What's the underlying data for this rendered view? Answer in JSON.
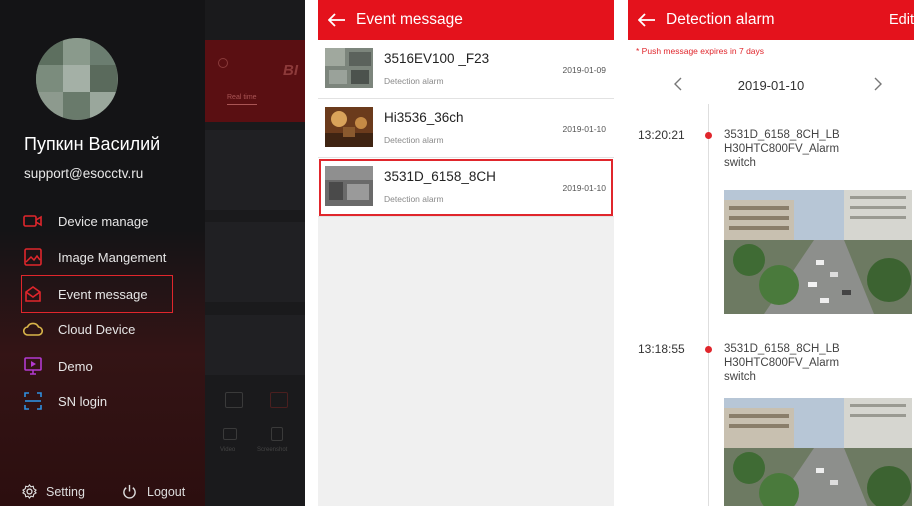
{
  "drawer": {
    "user_name": "Пупкин Василий",
    "user_email": "support@esocctv.ru",
    "menu": [
      {
        "label": "Device manage",
        "icon": "camera-icon",
        "color": "#e0262c"
      },
      {
        "label": "Image Mangement",
        "icon": "image-icon",
        "color": "#e0262c"
      },
      {
        "label": "Event message",
        "icon": "envelope-icon",
        "color": "#e0262c"
      },
      {
        "label": "Cloud Device",
        "icon": "cloud-icon",
        "color": "#d9b54a"
      },
      {
        "label": "Demo",
        "icon": "monitor-play-icon",
        "color": "#b23ad0"
      },
      {
        "label": "SN login",
        "icon": "barcode-icon",
        "color": "#2f8fe0"
      }
    ],
    "active_item": "Event message",
    "setting_label": "Setting",
    "logout_label": "Logout",
    "background_app": {
      "brand_fragment": "BI",
      "tab_label": "Real time",
      "video_label": "Video",
      "screenshot_label": "Screenshot"
    }
  },
  "event_message": {
    "title": "Event message",
    "items": [
      {
        "name": "3516EV100 _F23",
        "type": "Detection alarm",
        "date": "2019-01-09"
      },
      {
        "name": "Hi3536_36ch",
        "type": "Detection alarm",
        "date": "2019-01-10"
      },
      {
        "name": "3531D_6158_8CH",
        "type": "Detection alarm",
        "date": "2019-01-10"
      }
    ],
    "selected_index": 2
  },
  "detection_alarm": {
    "title": "Detection alarm",
    "edit_label": "Edit",
    "notice": "* Push message expires in 7 days",
    "current_date": "2019-01-10",
    "prev_symbol": "<",
    "next_symbol": ">",
    "alarms": [
      {
        "time": "13:20:21",
        "line1": "3531D_6158_8CH_LB",
        "line2": "H30HTC800FV_Alarm",
        "line3": "switch"
      },
      {
        "time": "13:18:55",
        "line1": "3531D_6158_8CH_LB",
        "line2": "H30HTC800FV_Alarm",
        "line3": "switch"
      }
    ]
  },
  "colors": {
    "accent_red": "#e4121c",
    "highlight_box": "#e0262c",
    "drawer_bg": "#141416"
  }
}
